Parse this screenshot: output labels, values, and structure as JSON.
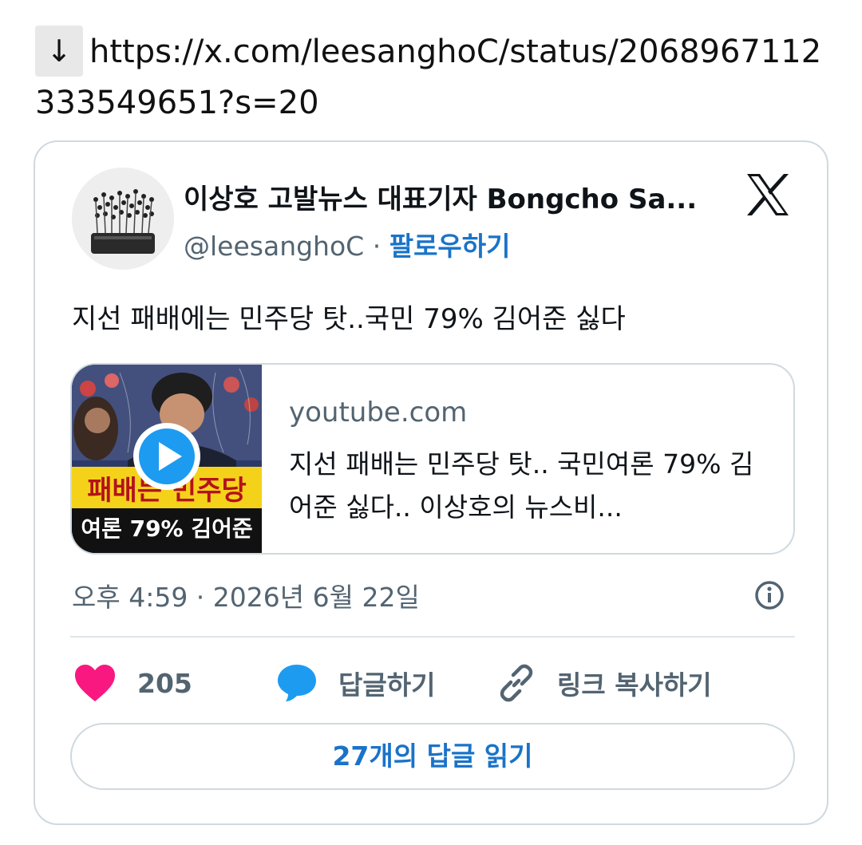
{
  "url_line": {
    "arrow": "↓",
    "url": "https://x.com/leesanghoC/status/2068967112333549651?s=20"
  },
  "tweet": {
    "author_name": "이상호 고발뉴스 대표기자 Bongcho Sa...",
    "handle": "@leesanghoC",
    "separator": "·",
    "follow_label": "팔로우하기",
    "text": "지선 패배에는 민주당 탓..국민 79% 김어준 싫다",
    "link_card": {
      "domain": "youtube.com",
      "title": "지선 패배는 민주당 탓.. 국민여론 79% 김어준 싫다.. 이상호의 뉴스비...",
      "thumb_line1": "패배는 민주당",
      "thumb_line2": "여론 79% 김어준"
    },
    "timestamp": "오후 4:59 · 2026년 6월 22일",
    "actions": {
      "like_count": "205",
      "reply_label": "답글하기",
      "copy_link_label": "링크 복사하기"
    },
    "read_replies_label": "27개의 답글 읽기"
  },
  "colors": {
    "accent": "#1a73c8",
    "heart": "#f91880",
    "reply_bubble": "#1d9bf0",
    "muted": "#536471",
    "border": "#cfd9de"
  },
  "icons": [
    "down-arrow-icon",
    "x-logo-icon",
    "play-icon",
    "info-icon",
    "heart-icon",
    "speech-bubble-icon",
    "link-icon"
  ]
}
